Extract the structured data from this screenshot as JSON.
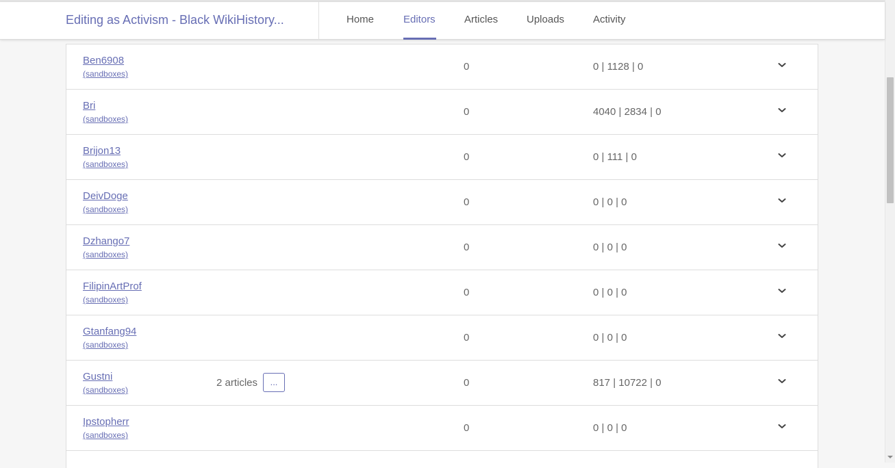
{
  "header": {
    "course_title": "Editing as Activism - Black WikiHistory...",
    "nav": [
      {
        "label": "Home",
        "active": false
      },
      {
        "label": "Editors",
        "active": true
      },
      {
        "label": "Articles",
        "active": false
      },
      {
        "label": "Uploads",
        "active": false
      },
      {
        "label": "Activity",
        "active": false
      }
    ]
  },
  "editors": {
    "sandbox_label": "(sandboxes)",
    "rows": [
      {
        "username": "Ben6908",
        "articles": "",
        "count": "0",
        "chars": "0 | 1128 | 0"
      },
      {
        "username": "Bri",
        "articles": "",
        "count": "0",
        "chars": "4040 | 2834 | 0"
      },
      {
        "username": "Brijon13",
        "articles": "",
        "count": "0",
        "chars": "0 | 111 | 0"
      },
      {
        "username": "DeivDoge",
        "articles": "",
        "count": "0",
        "chars": "0 | 0 | 0"
      },
      {
        "username": "Dzhango7",
        "articles": "",
        "count": "0",
        "chars": "0 | 0 | 0"
      },
      {
        "username": "FilipinArtProf",
        "articles": "",
        "count": "0",
        "chars": "0 | 0 | 0"
      },
      {
        "username": "Gtanfang94",
        "articles": "",
        "count": "0",
        "chars": "0 | 0 | 0"
      },
      {
        "username": "Gustni",
        "articles": "2 articles",
        "more_label": "...",
        "count": "0",
        "chars": "817 | 10722 | 0"
      },
      {
        "username": "Ipstopherr",
        "articles": "",
        "count": "0",
        "chars": "0 | 0 | 0"
      }
    ]
  },
  "icons": {
    "row_toggle": "chevron-down-icon"
  },
  "colors": {
    "accent": "#676eb4",
    "text": "#666666",
    "border": "#dddddd",
    "background": "#f6f6f6"
  }
}
